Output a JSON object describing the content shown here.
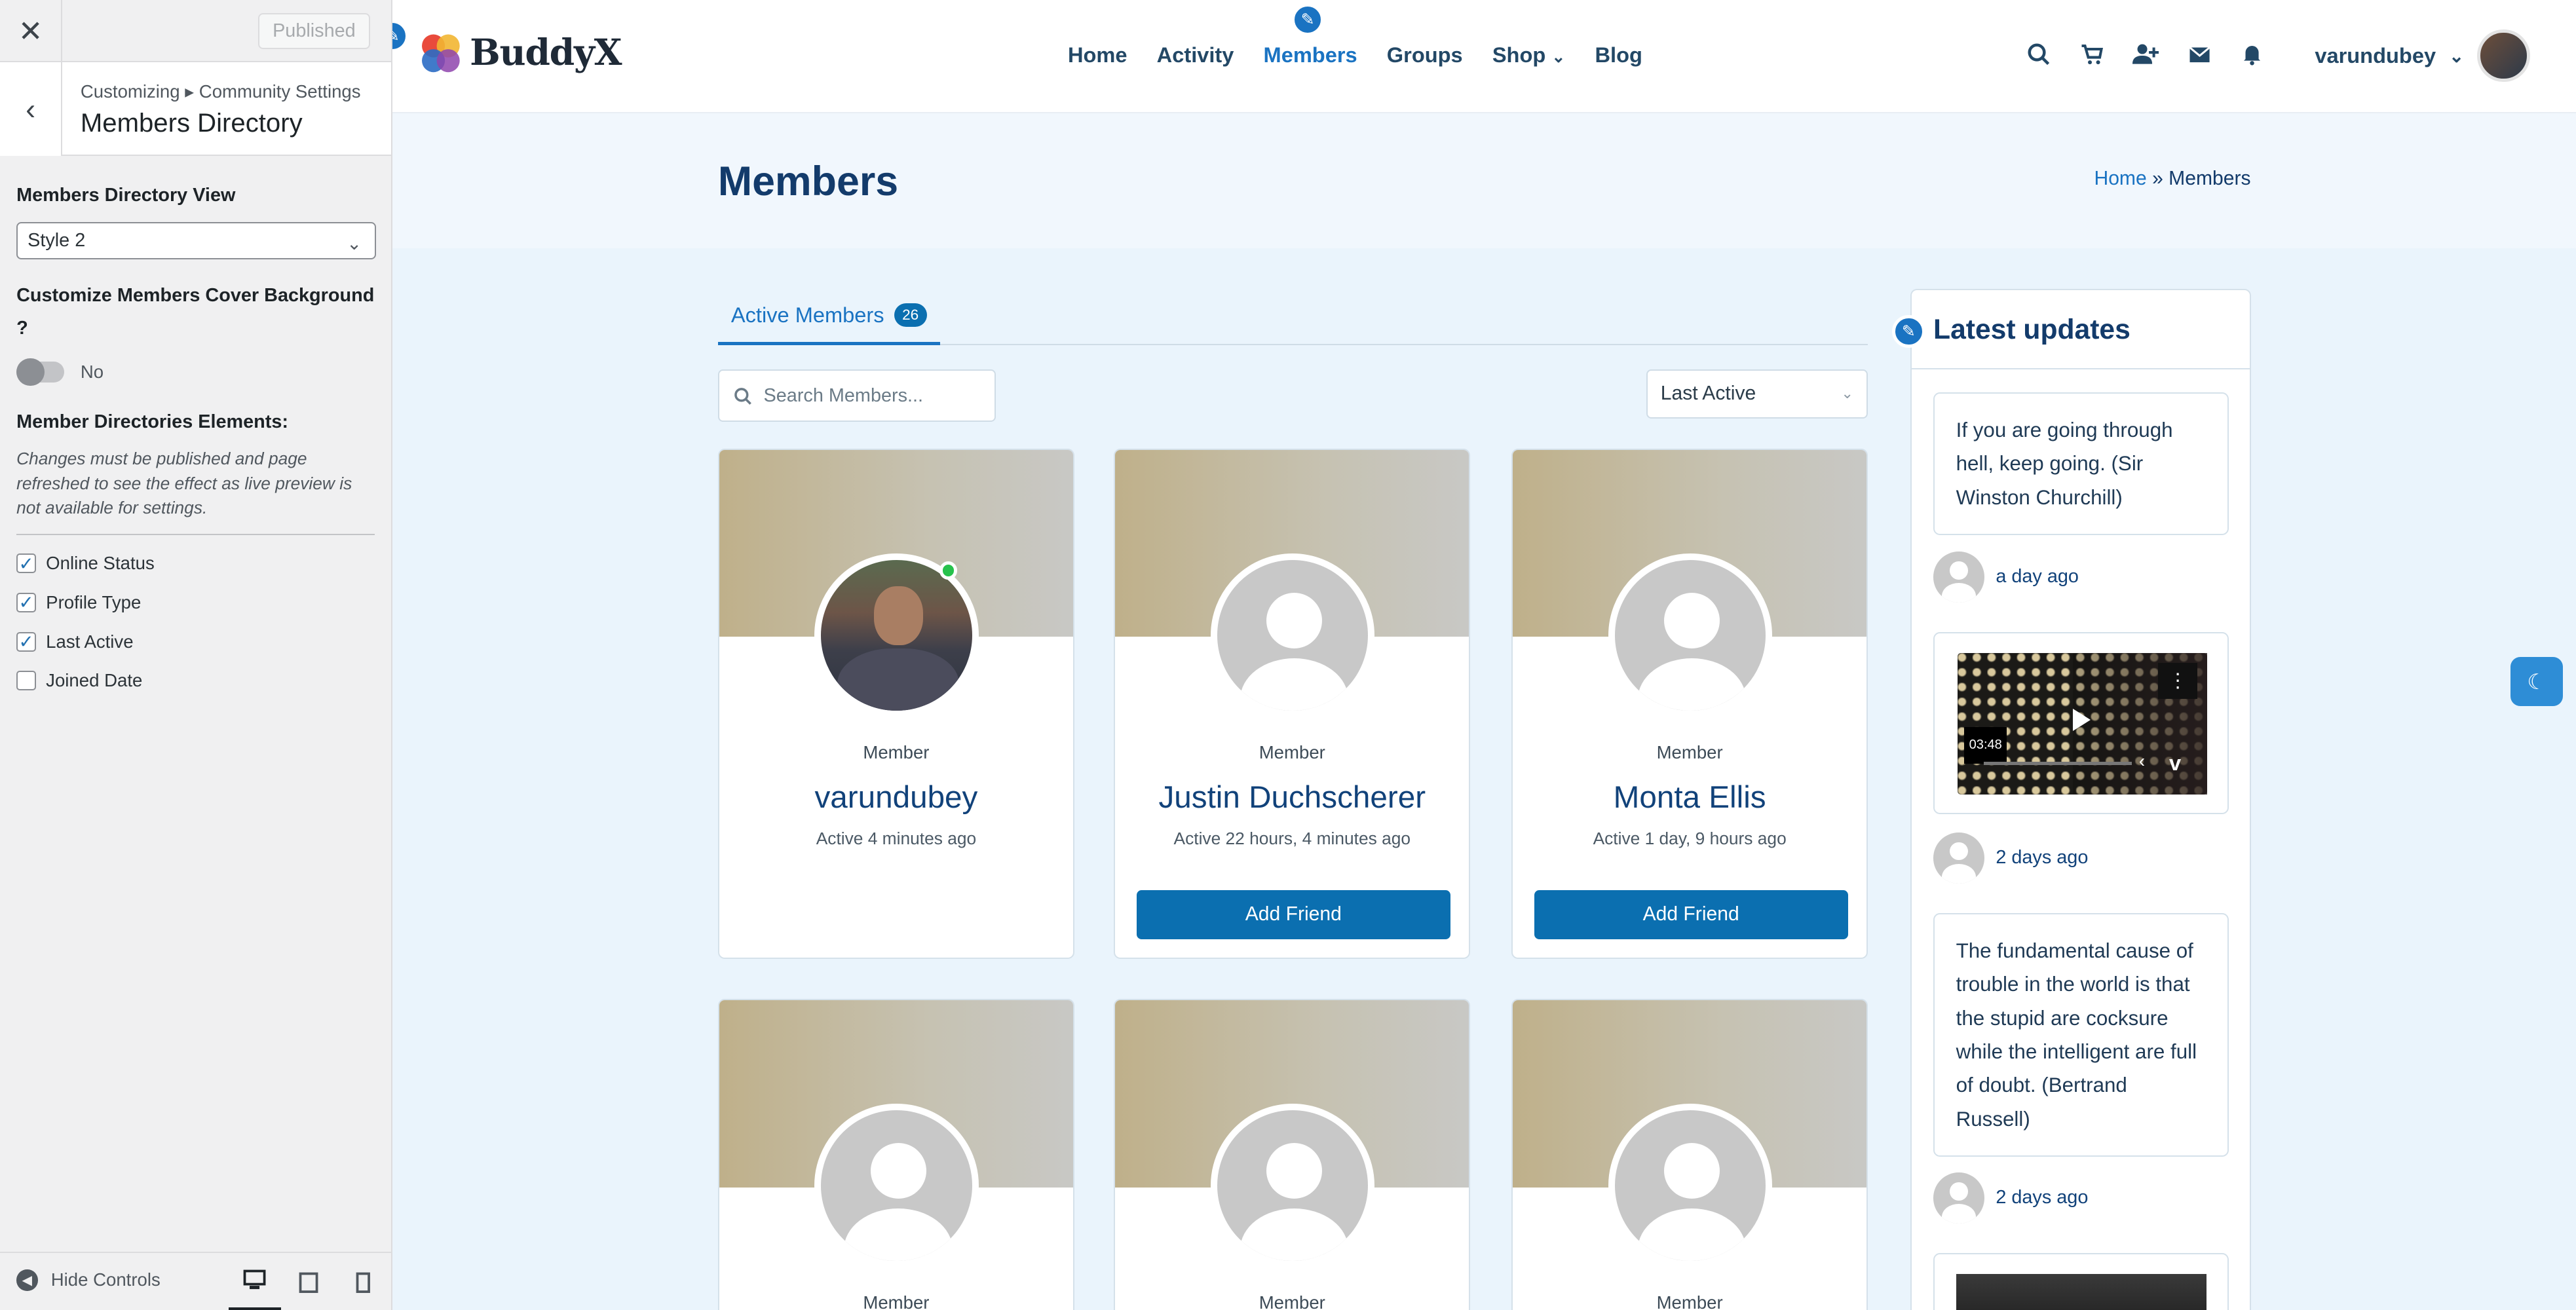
{
  "customizer": {
    "publish_label": "Published",
    "breadcrumb": "Customizing ▸ Community Settings",
    "section_title": "Members Directory",
    "view_label": "Members Directory View",
    "view_value": "Style 2",
    "cover_label": "Customize Members Cover Background ?",
    "cover_toggle_label": "No",
    "elements_label": "Member Directories Elements:",
    "elements_note": "Changes must be published and page refreshed to see the effect as live preview is not available for settings.",
    "checkboxes": [
      {
        "label": "Online Status",
        "checked": true
      },
      {
        "label": "Profile Type",
        "checked": true
      },
      {
        "label": "Last Active",
        "checked": true
      },
      {
        "label": "Joined Date",
        "checked": false
      }
    ],
    "hide_controls": "Hide Controls"
  },
  "site": {
    "logo_text": "BuddyX",
    "nav": [
      "Home",
      "Activity",
      "Members",
      "Groups",
      "Shop",
      "Blog"
    ],
    "active_nav": "Members",
    "username": "varundubey",
    "page_title": "Members",
    "breadcrumb_home": "Home",
    "breadcrumb_sep": "»",
    "breadcrumb_current": "Members",
    "tab_label": "Active Members",
    "tab_count": "26",
    "search_placeholder": "Search Members...",
    "sort_value": "Last Active",
    "members": [
      {
        "type": "Member",
        "name": "varundubey",
        "active": "Active 4 minutes ago",
        "button": ""
      },
      {
        "type": "Member",
        "name": "Justin Duchscherer",
        "active": "Active 22 hours, 4 minutes ago",
        "button": "Add Friend"
      },
      {
        "type": "Member",
        "name": "Monta Ellis",
        "active": "Active 1 day, 9 hours ago",
        "button": "Add Friend"
      },
      {
        "type": "Member"
      },
      {
        "type": "Member"
      },
      {
        "type": "Member"
      }
    ],
    "widget_title": "Latest updates",
    "updates": [
      {
        "text": "If you are going through hell, keep going. (Sir Winston Churchill)",
        "time": "a day ago"
      },
      {
        "video_time": "03:48",
        "time": "2 days ago"
      },
      {
        "text": "The fundamental cause of trouble in the world is that the stupid are cocksure while the intelligent are full of doubt. (Bertrand Russell)",
        "time": "2 days ago"
      }
    ]
  },
  "colors": {
    "accent": "#1a73c2",
    "button": "#0b6fb0",
    "heading": "#133b6b"
  }
}
